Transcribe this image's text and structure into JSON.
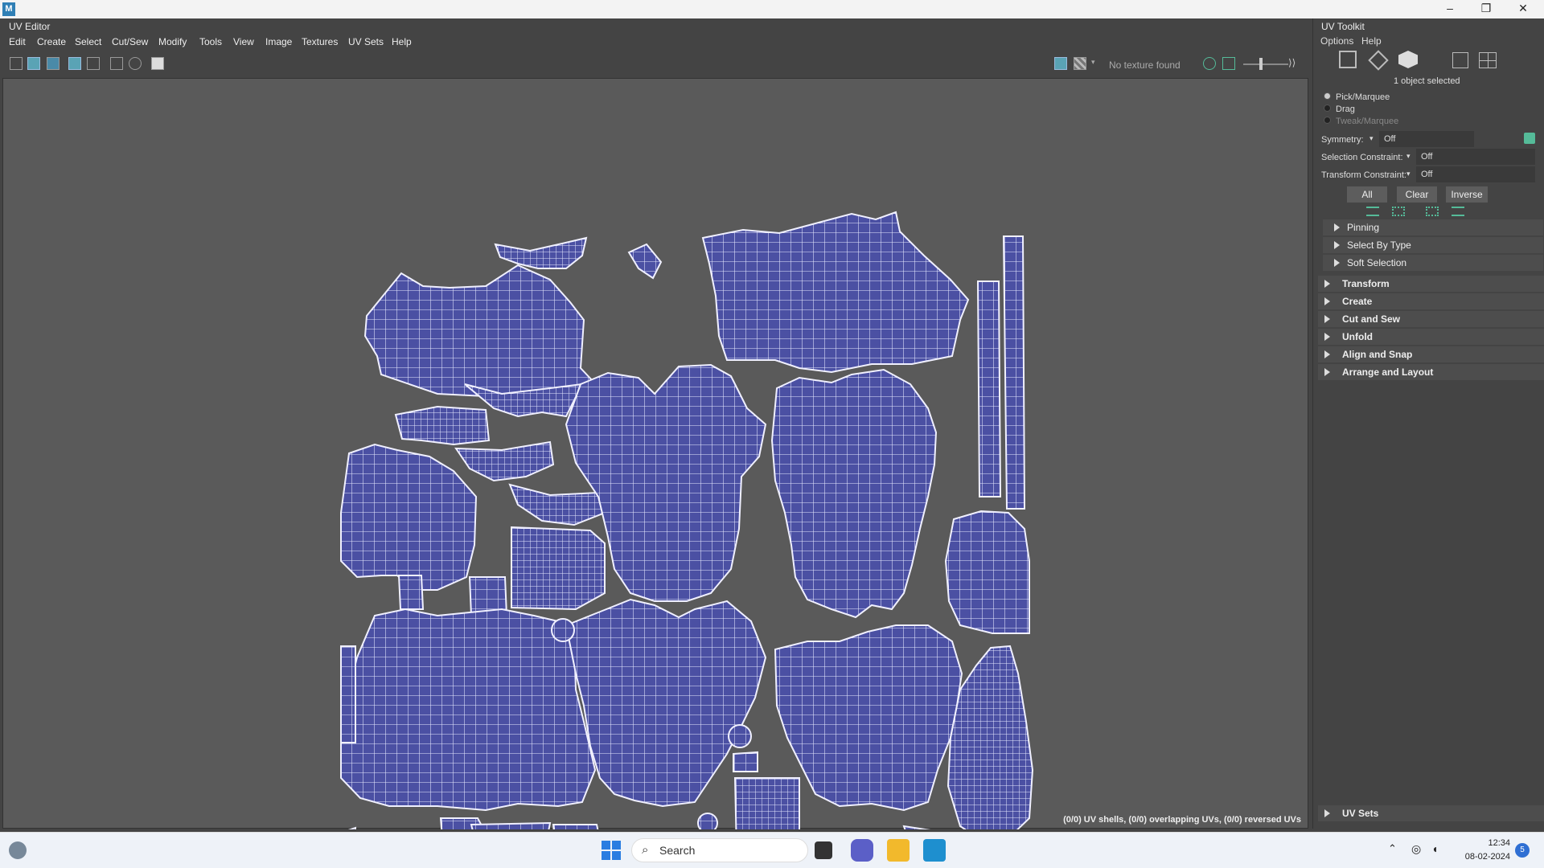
{
  "window": {
    "app_icon": "M",
    "minimize": "–",
    "restore": "❐",
    "close": "✕"
  },
  "uv_editor": {
    "title": "UV Editor",
    "menus": [
      "Edit",
      "Create",
      "Select",
      "Cut/Sew",
      "Modify",
      "Tools",
      "View",
      "Image",
      "Textures",
      "UV Sets",
      "Help"
    ],
    "texture_status": "No texture found",
    "status_line": "(0/0) UV shells, (0/0) overlapping UVs, (0/0) reversed UVs"
  },
  "toolkit": {
    "title": "UV Toolkit",
    "menus": [
      "Options",
      "Help"
    ],
    "selection_info": "1 object selected",
    "tools": [
      {
        "label": "Pick/Marquee",
        "selected": true,
        "enabled": true
      },
      {
        "label": "Drag",
        "selected": false,
        "enabled": true
      },
      {
        "label": "Tweak/Marquee",
        "selected": false,
        "enabled": false
      }
    ],
    "symmetry": {
      "label": "Symmetry:",
      "value": "Off"
    },
    "selection_constraint": {
      "label": "Selection Constraint:",
      "value": "Off"
    },
    "transform_constraint": {
      "label": "Transform Constraint:",
      "value": "Off"
    },
    "buttons": {
      "all": "All",
      "clear": "Clear",
      "inverse": "Inverse"
    },
    "subsections": [
      "Pinning",
      "Select By Type",
      "Soft Selection"
    ],
    "sections": [
      "Transform",
      "Create",
      "Cut and Sew",
      "Unfold",
      "Align and Snap",
      "Arrange and Layout"
    ],
    "uv_sets": "UV Sets"
  },
  "taskbar": {
    "search_placeholder": "Search",
    "time": "12:34",
    "date": "08-02-2024",
    "notification_count": "5"
  },
  "colors": {
    "uv_shell": "#4b50a3",
    "uv_wire": "#e6e8ff",
    "viewport": "#5a5a5a",
    "accent": "#5aa3b5"
  }
}
